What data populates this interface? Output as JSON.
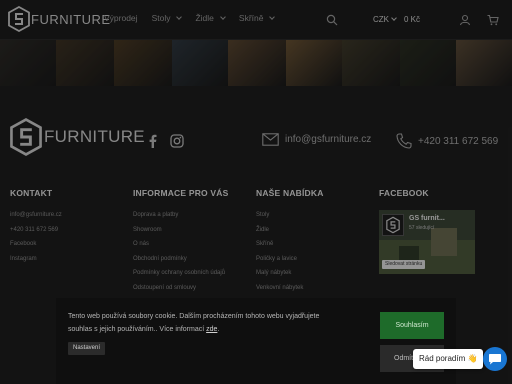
{
  "header": {
    "logo_text": "FURNITURE",
    "nav": [
      {
        "label": "Výprodej",
        "has_dropdown": false
      },
      {
        "label": "Stoly",
        "has_dropdown": true
      },
      {
        "label": "Židle",
        "has_dropdown": true
      },
      {
        "label": "Skříně",
        "has_dropdown": true
      }
    ],
    "icons": [
      "search-icon",
      "user-icon",
      "cart-icon"
    ],
    "currency": "CZK",
    "cart_total": "0 Kč"
  },
  "gallery": {
    "colors": [
      "#2c2a26",
      "#3e3324",
      "#4a3a24",
      "#2f3840",
      "#5a4630",
      "#6a5334",
      "#3f3a2a",
      "#2a2e22",
      "#5b4b38",
      "#463a2c",
      "#3a3a26"
    ]
  },
  "footer": {
    "logo_text": "FURNITURE",
    "social": [
      "facebook-icon",
      "instagram-icon"
    ],
    "email": "info@gsfurniture.cz",
    "phone": "+420 311 672 569",
    "columns": [
      {
        "heading": "KONTAKT",
        "links": [
          "info@gsfurniture.cz",
          "+420 311 672 569",
          "Facebook",
          "Instagram"
        ]
      },
      {
        "heading": "INFORMACE PRO VÁS",
        "links": [
          "Doprava a platby",
          "Showroom",
          "O nás",
          "Obchodní podmínky",
          "Podmínky ochrany osobních údajů",
          "Odstoupení od smlouvy"
        ]
      },
      {
        "heading": "NAŠE NABÍDKA",
        "links": [
          "Stoly",
          "Židle",
          "Skříně",
          "Poličky a lavice",
          "Malý nábytek",
          "Venkovní nábytek"
        ]
      },
      {
        "heading": "FACEBOOK",
        "links": []
      }
    ],
    "facebook_widget": {
      "page_name": "GS furnit...",
      "likes": "57 sledující",
      "button": "Sledovat stránku"
    }
  },
  "cookie": {
    "text": "Tento web používá soubory cookie. Dalším procházením tohoto webu vyjadřujete souhlas s jejich používáním.. Více informací",
    "link": "zde",
    "text_end": ".",
    "settings_button": "Nastavení",
    "accept_button": "Souhlasím",
    "reject_button": "Odmítnout"
  },
  "chat": {
    "label": "Rád poradím 👋"
  }
}
